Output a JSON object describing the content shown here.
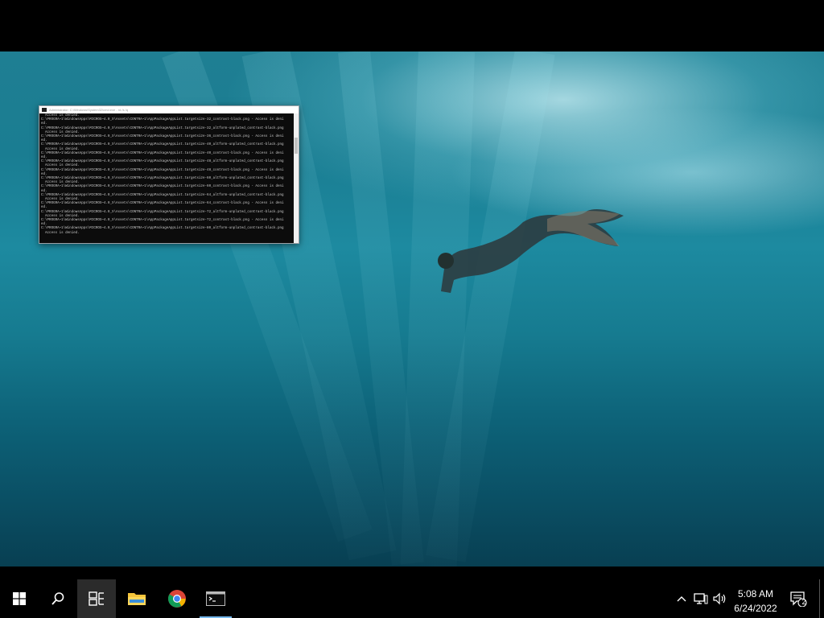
{
  "cmd": {
    "title": "Administrator: C:\\Windows\\System32\\cmd.exe - rd /s /q",
    "lines": [
      "  Access is denied.",
      "C:\\PROGRA~1\\WindowsApps\\MICROS~4.0_X\\Assets\\CONTRA~1\\AppPackageAppList.targetsize-32_contrast-black.png - Access is deni",
      "ed.",
      "C:\\PROGRA~1\\WindowsApps\\MICROS~4.0_X\\Assets\\CONTRA~1\\AppPackageAppList.targetsize-32_altform-unplated_contrast-black.png",
      "  Access is denied.",
      "C:\\PROGRA~1\\WindowsApps\\MICROS~4.0_X\\Assets\\CONTRA~1\\AppPackageAppList.targetsize-36_contrast-black.png - Access is deni",
      "ed.",
      "C:\\PROGRA~1\\WindowsApps\\MICROS~4.0_X\\Assets\\CONTRA~1\\AppPackageAppList.targetsize-40_altform-unplated_contrast-black.png",
      "  Access is denied.",
      "C:\\PROGRA~1\\WindowsApps\\MICROS~4.0_X\\Assets\\CONTRA~1\\AppPackageAppList.targetsize-40_contrast-black.png - Access is deni",
      "ed.",
      "C:\\PROGRA~1\\WindowsApps\\MICROS~4.0_X\\Assets\\CONTRA~1\\AppPackageAppList.targetsize-48_altform-unplated_contrast-black.png",
      "  Access is denied.",
      "C:\\PROGRA~1\\WindowsApps\\MICROS~4.0_X\\Assets\\CONTRA~1\\AppPackageAppList.targetsize-48_contrast-black.png - Access is deni",
      "ed.",
      "C:\\PROGRA~1\\WindowsApps\\MICROS~4.0_X\\Assets\\CONTRA~1\\AppPackageAppList.targetsize-60_altform-unplated_contrast-black.png",
      "  Access is denied.",
      "C:\\PROGRA~1\\WindowsApps\\MICROS~4.0_X\\Assets\\CONTRA~1\\AppPackageAppList.targetsize-60_contrast-black.png - Access is deni",
      "ed.",
      "C:\\PROGRA~1\\WindowsApps\\MICROS~4.0_X\\Assets\\CONTRA~1\\AppPackageAppList.targetsize-64_altform-unplated_contrast-black.png",
      "  Access is denied.",
      "C:\\PROGRA~1\\WindowsApps\\MICROS~4.0_X\\Assets\\CONTRA~1\\AppPackageAppList.targetsize-64_contrast-black.png - Access is deni",
      "ed.",
      "C:\\PROGRA~1\\WindowsApps\\MICROS~4.0_X\\Assets\\CONTRA~1\\AppPackageAppList.targetsize-72_altform-unplated_contrast-black.png",
      "  Access is denied.",
      "C:\\PROGRA~1\\WindowsApps\\MICROS~4.0_X\\Assets\\CONTRA~1\\AppPackageAppList.targetsize-72_contrast-black.png - Access is deni",
      "ed.",
      "C:\\PROGRA~1\\WindowsApps\\MICROS~4.0_X\\Assets\\CONTRA~1\\AppPackageAppList.targetsize-80_altform-unplated_contrast-black.png",
      "  Access is denied."
    ]
  },
  "taskbar": {
    "items": [
      {
        "name": "start-button",
        "icon": "windows-logo-icon"
      },
      {
        "name": "search-button",
        "icon": "search-icon"
      },
      {
        "name": "task-view-button",
        "icon": "task-view-icon"
      },
      {
        "name": "file-explorer-button",
        "icon": "folder-icon"
      },
      {
        "name": "chrome-button",
        "icon": "chrome-icon"
      },
      {
        "name": "cmd-button",
        "icon": "cmd-icon"
      }
    ],
    "tray": {
      "time": "5:08 AM",
      "date": "6/24/2022",
      "notification_count": "2"
    }
  },
  "colors": {
    "taskbar_bg": "#000000",
    "running_indicator": "#76b9ed",
    "wallpaper_teal": "#1a7d92"
  }
}
